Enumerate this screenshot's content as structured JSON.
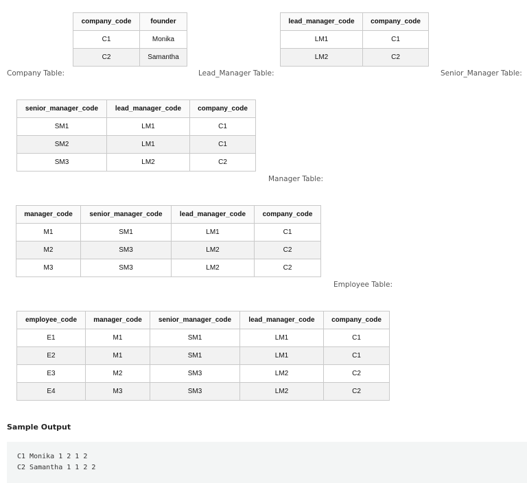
{
  "tables": {
    "company": {
      "caption": "Company Table:",
      "headers": [
        "company_code",
        "founder"
      ],
      "rows": [
        [
          "C1",
          "Monika"
        ],
        [
          "C2",
          "Samantha"
        ]
      ]
    },
    "lead_manager": {
      "caption": "Lead_Manager Table:",
      "headers": [
        "lead_manager_code",
        "company_code"
      ],
      "rows": [
        [
          "LM1",
          "C1"
        ],
        [
          "LM2",
          "C2"
        ]
      ]
    },
    "senior_manager": {
      "caption": "Senior_Manager Table:",
      "headers": [
        "senior_manager_code",
        "lead_manager_code",
        "company_code"
      ],
      "rows": [
        [
          "SM1",
          "LM1",
          "C1"
        ],
        [
          "SM2",
          "LM1",
          "C1"
        ],
        [
          "SM3",
          "LM2",
          "C2"
        ]
      ]
    },
    "manager": {
      "caption": "Manager Table:",
      "headers": [
        "manager_code",
        "senior_manager_code",
        "lead_manager_code",
        "company_code"
      ],
      "rows": [
        [
          "M1",
          "SM1",
          "LM1",
          "C1"
        ],
        [
          "M2",
          "SM3",
          "LM2",
          "C2"
        ],
        [
          "M3",
          "SM3",
          "LM2",
          "C2"
        ]
      ]
    },
    "employee": {
      "caption": "Employee Table:",
      "headers": [
        "employee_code",
        "manager_code",
        "senior_manager_code",
        "lead_manager_code",
        "company_code"
      ],
      "rows": [
        [
          "E1",
          "M1",
          "SM1",
          "LM1",
          "C1"
        ],
        [
          "E2",
          "M1",
          "SM1",
          "LM1",
          "C1"
        ],
        [
          "E3",
          "M2",
          "SM3",
          "LM2",
          "C2"
        ],
        [
          "E4",
          "M3",
          "SM3",
          "LM2",
          "C2"
        ]
      ]
    }
  },
  "sample_output": {
    "heading": "Sample Output",
    "lines": [
      "C1 Monika 1 2 1 2",
      "C2 Samantha 1 1 2 2"
    ]
  }
}
